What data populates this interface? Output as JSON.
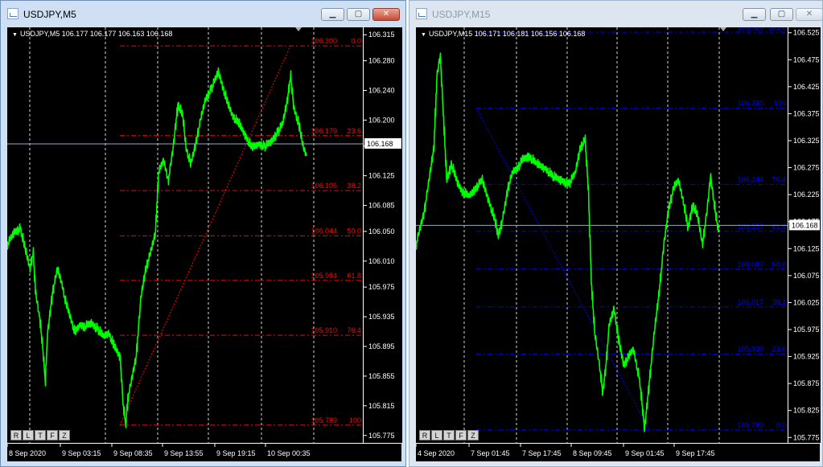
{
  "left": {
    "title": "USDJPY,M5",
    "header": "USDJPY,M5  106.177 106.177 106.163 106.168",
    "price_ticks": [
      "106.315",
      "106.280",
      "106.240",
      "106.200",
      "106.165",
      "106.125",
      "106.085",
      "106.050",
      "106.010",
      "105.975",
      "105.935",
      "105.895",
      "105.855",
      "105.815",
      "105.775"
    ],
    "price_range": [
      105.765,
      106.325
    ],
    "current_price": "106.168",
    "time_labels": [
      "8 Sep 2020",
      "9 Sep 03:15",
      "9 Sep 08:35",
      "9 Sep 13:55",
      "9 Sep 19:15",
      "10 Sep 00:35"
    ],
    "fib_levels": [
      {
        "price": "106.300",
        "ratio": "0.0"
      },
      {
        "price": "106.179",
        "ratio": "23.6"
      },
      {
        "price": "106.105",
        "ratio": "38.2"
      },
      {
        "price": "106.044",
        "ratio": "50.0"
      },
      {
        "price": "105.984",
        "ratio": "61.8"
      },
      {
        "price": "105.910",
        "ratio": "76.4"
      },
      {
        "price": "105.789",
        "ratio": "100"
      }
    ],
    "fib_color": "#ff0000",
    "scale_buttons": [
      "R",
      "L",
      "T",
      "F",
      "Z"
    ]
  },
  "right": {
    "title": "USDJPY,M15",
    "header": "USDJPY,M15  106.171 106.181 106.156 106.168",
    "price_ticks": [
      "106.525",
      "106.475",
      "106.425",
      "106.375",
      "106.325",
      "106.275",
      "106.225",
      "106.175",
      "106.125",
      "106.075",
      "106.025",
      "105.975",
      "105.925",
      "105.875",
      "105.825",
      "105.775"
    ],
    "price_range": [
      105.765,
      106.535
    ],
    "current_price": "106.168",
    "time_labels": [
      "4 Sep 2020",
      "7 Sep 01:45",
      "7 Sep 17:45",
      "8 Sep 09:45",
      "9 Sep 01:45",
      "9 Sep 17:45"
    ],
    "fib_levels": [
      {
        "price": "106.526",
        "ratio": "161.8"
      },
      {
        "price": "106.385",
        "ratio": "100"
      },
      {
        "price": "106.244",
        "ratio": "76.4"
      },
      {
        "price": "106.157",
        "ratio": "61.8"
      },
      {
        "price": "106.087",
        "ratio": "50.0"
      },
      {
        "price": "106.017",
        "ratio": "38.2"
      },
      {
        "price": "105.930",
        "ratio": "23.6"
      },
      {
        "price": "105.789",
        "ratio": "0.0"
      }
    ],
    "fib_color": "#0000ff",
    "scale_buttons": [
      "R",
      "L",
      "T",
      "F",
      "Z"
    ]
  },
  "candle_color": "#00ff00",
  "window_buttons": {
    "minimize": "▁",
    "restore": "▢",
    "close": "✕"
  }
}
